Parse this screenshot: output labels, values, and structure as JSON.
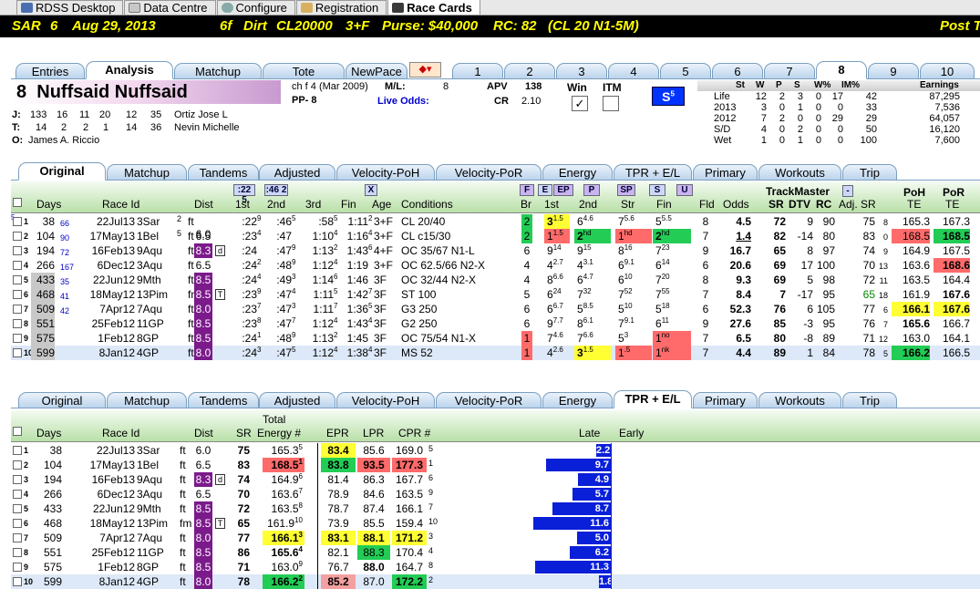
{
  "menu": {
    "tabs": [
      "RDSS Desktop",
      "Data Centre",
      "Configure",
      "Registration",
      "Race Cards"
    ]
  },
  "race": {
    "track": "SAR",
    "race": "6",
    "date": "Aug 29, 2013",
    "dist": "6f",
    "surface": "Dirt",
    "cls": "CL20000",
    "age": "3+F",
    "purse": "Purse: $40,000",
    "rc": "RC: 82",
    "rcdesc": "(CL 20 N1-5M)",
    "post": "Post T"
  },
  "tabs1": [
    "Entries",
    "Analysis",
    "Matchup",
    "Tote",
    "NewPace",
    "1",
    "2",
    "3",
    "4",
    "5",
    "6",
    "7",
    "8",
    "9",
    "10"
  ],
  "horse": {
    "pp_no": "8",
    "name": "Nuffsaid Nuffsaid",
    "desc": "ch f 4  (Mar 2009)",
    "pp": "PP- 8",
    "ml_label": "M/L:",
    "ml": "8",
    "live": "Live Odds:",
    "apv_l": "APV",
    "apv": "138",
    "cr_l": "CR",
    "cr": "2.10",
    "win": "Win",
    "itm": "ITM",
    "s_badge": "S",
    "s_sup": "5",
    "j_label": "J:",
    "j_stats": [
      "133",
      "16",
      "11",
      "20",
      "12",
      "35"
    ],
    "jockey": "Ortiz Jose L",
    "t_label": "T:",
    "t_stats": [
      "14",
      "2",
      "2",
      "1",
      "14",
      "36"
    ],
    "trainer": "Nevin Michelle",
    "o_label": "O:",
    "owner": "James A. Riccio"
  },
  "career": {
    "headers": [
      "St",
      "W",
      "P",
      "S",
      "W%",
      "IM%",
      "Earnings"
    ],
    "rows": [
      [
        "Life",
        "12",
        "2",
        "3",
        "0",
        "17",
        "42",
        "87,295"
      ],
      [
        "2013",
        "3",
        "0",
        "1",
        "0",
        "0",
        "33",
        "7,536"
      ],
      [
        "2012",
        "7",
        "2",
        "0",
        "0",
        "29",
        "29",
        "64,057"
      ],
      [
        "S/D",
        "4",
        "0",
        "2",
        "0",
        "0",
        "50",
        "16,120"
      ],
      [
        "Wet",
        "1",
        "0",
        "1",
        "0",
        "0",
        "100",
        "7,600"
      ]
    ]
  },
  "tabs2": [
    "Original",
    "Matchup",
    "Tandems",
    "Adjusted",
    "Velocity-PoH",
    "Velocity-PoR",
    "Energy",
    "TPR + E/L",
    "Primary",
    "Workouts",
    "Trip"
  ],
  "grid1": {
    "hdr_btns": [
      ":22 5",
      ":46 2",
      "X",
      "F",
      "E",
      "EP",
      "P",
      "SP",
      "S",
      "U"
    ],
    "headers": {
      "days": "Days",
      "raceid": "Race Id",
      "dist": "Dist",
      "f1": "1st",
      "f2": "2nd",
      "f3": "3rd",
      "fin": "Fin",
      "age": "Age",
      "cond": "Conditions",
      "br": "Br",
      "c1": "1st",
      "c2": "2nd",
      "str": "Str",
      "cfin": "Fin",
      "fld": "Fld",
      "odds": "Odds",
      "tm": "TrackMaster",
      "sr": "SR",
      "dtv": "DTV",
      "rc": "RC",
      "adj": "Adj. SR",
      "poh": "PoH",
      "por": "PoR",
      "te": "TE",
      "te2": "TE"
    },
    "rows": [
      {
        "n": "1",
        "days": "38",
        "dsup": "5",
        "dsub": "66",
        "date": "22Jul13",
        "trk": "3Sar",
        "rs": "2",
        "sf": "ft",
        "dist": "6.0",
        "f1": ":22",
        "f1s": "9",
        "f2": ":46",
        "f2s": "5",
        "f3": ":58",
        "f3s": "5",
        "fin": "1:11",
        "fins": "2",
        "age": "3+F",
        "cond": "CL 20/40",
        "br": "2",
        "c1": "3",
        "c1s": "1.5",
        "c2": "6",
        "c2s": "4.6",
        "str": "7",
        "strs": "5.6",
        "cfin": "5",
        "cfins": "5.5",
        "fld": "8",
        "odds": "4.5",
        "sr": "72",
        "dtv": "9",
        "rc": "90",
        "adj": "75",
        "adjs": "8",
        "poh": "165.3",
        "por": "167.3"
      },
      {
        "n": "2",
        "days": "104",
        "dsup": "",
        "dsub": "90",
        "date": "17May13",
        "trk": "1Bel",
        "rs": "5",
        "sf": "ft",
        "dist": "6.5",
        "f1": ":23",
        "f1s": "4",
        "f2": ":47",
        "f2s": "",
        "f3": "1:10",
        "f3s": "4",
        "fin": "1:16",
        "fins": "4",
        "age": "3+F",
        "cond": "CL c15/30",
        "br": "2",
        "c1": "1",
        "c1s": "1.5",
        "c2": "2",
        "c2s": "hd",
        "str": "1",
        "strs": "hd",
        "cfin": "2",
        "cfins": "hd",
        "fld": "7",
        "odds": "1.4",
        "sr": "82",
        "dtv": "-14",
        "rc": "80",
        "adj": "83",
        "adjs": "0",
        "poh": "168.5",
        "por": "168.5"
      },
      {
        "n": "3",
        "days": "194",
        "dsup": "",
        "dsub": "72",
        "date": "16Feb13",
        "trk": "9Aqu",
        "rs": "",
        "sf": "ft",
        "dist": "8.3",
        "f1": ":24",
        "f1s": "",
        "f2": ":47",
        "f2s": "9",
        "f3": "1:13",
        "f3s": "2",
        "fin": "1:43",
        "fins": "6",
        "age": "4+F",
        "cond": "OC 35/67 N1-L",
        "br": "6",
        "c1": "9",
        "c1s": "14",
        "c2": "9",
        "c2s": "15",
        "str": "8",
        "strs": "16",
        "cfin": "7",
        "cfins": "23",
        "fld": "9",
        "odds": "16.7",
        "sr": "65",
        "dtv": "8",
        "rc": "97",
        "adj": "74",
        "adjs": "9",
        "poh": "164.9",
        "por": "167.5"
      },
      {
        "n": "4",
        "days": "266",
        "dsup": "",
        "dsub": "167",
        "date": "6Dec12",
        "trk": "3Aqu",
        "rs": "",
        "sf": "ft",
        "dist": "6.5",
        "f1": ":24",
        "f1s": "2",
        "f2": ":48",
        "f2s": "9",
        "f3": "1:12",
        "f3s": "4",
        "fin": "1:19",
        "fins": "",
        "age": "3+F",
        "cond": "OC 62.5/66 N2-X",
        "br": "4",
        "c1": "4",
        "c1s": "2.7",
        "c2": "4",
        "c2s": "3.1",
        "str": "6",
        "strs": "9.1",
        "cfin": "6",
        "cfins": "14",
        "fld": "6",
        "odds": "20.6",
        "sr": "69",
        "dtv": "17",
        "rc": "100",
        "adj": "70",
        "adjs": "13",
        "poh": "163.6",
        "por": "168.6"
      },
      {
        "n": "5",
        "days": "433",
        "dsup": "",
        "dsub": "35",
        "date": "22Jun12",
        "trk": "9Mth",
        "rs": "",
        "sf": "ft",
        "dist": "8.5",
        "f1": ":24",
        "f1s": "4",
        "f2": ":49",
        "f2s": "3",
        "f3": "1:14",
        "f3s": "6",
        "fin": "1:46",
        "fins": "",
        "age": "3F",
        "cond": "OC 32/44 N2-X",
        "br": "4",
        "c1": "8",
        "c1s": "6.6",
        "c2": "6",
        "c2s": "4.7",
        "str": "6",
        "strs": "10",
        "cfin": "7",
        "cfins": "20",
        "fld": "8",
        "odds": "9.3",
        "sr": "69",
        "dtv": "5",
        "rc": "98",
        "adj": "72",
        "adjs": "11",
        "poh": "163.5",
        "por": "164.4"
      },
      {
        "n": "6",
        "days": "468",
        "dsup": "",
        "dsub": "41",
        "date": "18May12",
        "trk": "13Pim",
        "rs": "",
        "sf": "fm",
        "dist": "8.5",
        "f1": ":23",
        "f1s": "9",
        "f2": ":47",
        "f2s": "4",
        "f3": "1:11",
        "f3s": "5",
        "fin": "1:42",
        "fins": "7",
        "age": "3F",
        "cond": "ST 100",
        "br": "5",
        "c1": "6",
        "c1s": "24",
        "c2": "7",
        "c2s": "32",
        "str": "7",
        "strs": "52",
        "cfin": "7",
        "cfins": "55",
        "fld": "7",
        "odds": "8.4",
        "sr": "7",
        "dtv": "-17",
        "rc": "95",
        "adj": "65",
        "adjs": "18",
        "poh": "161.9",
        "por": "167.6"
      },
      {
        "n": "7",
        "days": "509",
        "dsup": "",
        "dsub": "42",
        "date": "7Apr12",
        "trk": "7Aqu",
        "rs": "",
        "sf": "ft",
        "dist": "8.0",
        "f1": ":23",
        "f1s": "7",
        "f2": ":47",
        "f2s": "3",
        "f3": "1:11",
        "f3s": "7",
        "fin": "1:36",
        "fins": "5",
        "age": "3F",
        "cond": "G3 250",
        "br": "6",
        "c1": "6",
        "c1s": "6.7",
        "c2": "5",
        "c2s": "8.5",
        "str": "5",
        "strs": "10",
        "cfin": "5",
        "cfins": "18",
        "fld": "6",
        "odds": "52.3",
        "sr": "76",
        "dtv": "6",
        "rc": "105",
        "adj": "77",
        "adjs": "6",
        "poh": "166.1",
        "por": "167.6"
      },
      {
        "n": "8",
        "days": "551",
        "dsup": "",
        "dsub": "",
        "date": "25Feb12",
        "trk": "11GP",
        "rs": "",
        "sf": "ft",
        "dist": "8.5",
        "f1": ":23",
        "f1s": "8",
        "f2": ":47",
        "f2s": "7",
        "f3": "1:12",
        "f3s": "4",
        "fin": "1:43",
        "fins": "4",
        "age": "3F",
        "cond": "G2 250",
        "br": "6",
        "c1": "9",
        "c1s": "7.7",
        "c2": "8",
        "c2s": "6.1",
        "str": "7",
        "strs": "9.1",
        "cfin": "6",
        "cfins": "11",
        "fld": "9",
        "odds": "27.6",
        "sr": "85",
        "dtv": "-3",
        "rc": "95",
        "adj": "76",
        "adjs": "7",
        "poh": "165.6",
        "por": "166.7"
      },
      {
        "n": "9",
        "days": "575",
        "dsup": "",
        "dsub": "",
        "date": "1Feb12",
        "trk": "8GP",
        "rs": "",
        "sf": "ft",
        "dist": "8.5",
        "f1": ":24",
        "f1s": "1",
        "f2": ":48",
        "f2s": "9",
        "f3": "1:13",
        "f3s": "2",
        "fin": "1:45",
        "fins": "",
        "age": "3F",
        "cond": "OC 75/54 N1-X",
        "br": "1",
        "c1": "7",
        "c1s": "4.6",
        "c2": "7",
        "c2s": "6.6",
        "str": "5",
        "strs": "3",
        "cfin": "1",
        "cfins": "no",
        "fld": "7",
        "odds": "6.5",
        "sr": "80",
        "dtv": "-8",
        "rc": "89",
        "adj": "71",
        "adjs": "12",
        "poh": "163.0",
        "por": "164.1"
      },
      {
        "n": "10",
        "days": "599",
        "dsup": "",
        "dsub": "",
        "date": "8Jan12",
        "trk": "4GP",
        "rs": "",
        "sf": "ft",
        "dist": "8.0",
        "f1": ":24",
        "f1s": "3",
        "f2": ":47",
        "f2s": "5",
        "f3": "1:12",
        "f3s": "4",
        "fin": "1:38",
        "fins": "4",
        "age": "3F",
        "cond": "MS 52",
        "br": "1",
        "c1": "4",
        "c1s": "2.6",
        "c2": "3",
        "c2s": "1.5",
        "str": "1",
        "strs": ".5",
        "cfin": "1",
        "cfins": "nk",
        "fld": "7",
        "odds": "4.4",
        "sr": "89",
        "dtv": "1",
        "rc": "84",
        "adj": "78",
        "adjs": "5",
        "poh": "166.2",
        "por": "166.5"
      }
    ]
  },
  "grid2": {
    "headers": {
      "days": "Days",
      "raceid": "Race Id",
      "dist": "Dist",
      "sr": "SR",
      "total": "Total",
      "energy": "Energy #",
      "epr": "EPR",
      "lpr": "LPR",
      "cpr": "CPR #",
      "late": "Late",
      "early": "Early"
    },
    "rows": [
      {
        "n": "1",
        "days": "38",
        "date": "22Jul13",
        "trk": "3Sar",
        "sf": "ft",
        "dist": "6.0",
        "sr": "75",
        "en": "165.3",
        "ens": "5",
        "epr": "83.4",
        "lpr": "85.6",
        "cpr": "169.0",
        "cprs": "5",
        "late": "2.2",
        "lateval": 2.2
      },
      {
        "n": "2",
        "days": "104",
        "date": "17May13",
        "trk": "1Bel",
        "sf": "ft",
        "dist": "6.5",
        "sr": "83",
        "en": "168.5",
        "ens": "1",
        "epr": "83.8",
        "lpr": "93.5",
        "cpr": "177.3",
        "cprs": "1",
        "late": "9.7",
        "lateval": 9.7
      },
      {
        "n": "3",
        "days": "194",
        "date": "16Feb13",
        "trk": "9Aqu",
        "sf": "ft",
        "dist": "8.3",
        "sr": "74",
        "en": "164.9",
        "ens": "6",
        "epr": "81.4",
        "lpr": "86.3",
        "cpr": "167.7",
        "cprs": "6",
        "late": "4.9",
        "lateval": 4.9
      },
      {
        "n": "4",
        "days": "266",
        "date": "6Dec12",
        "trk": "3Aqu",
        "sf": "ft",
        "dist": "6.5",
        "sr": "70",
        "en": "163.6",
        "ens": "7",
        "epr": "78.9",
        "lpr": "84.6",
        "cpr": "163.5",
        "cprs": "9",
        "late": "5.7",
        "lateval": 5.7
      },
      {
        "n": "5",
        "days": "433",
        "date": "22Jun12",
        "trk": "9Mth",
        "sf": "ft",
        "dist": "8.5",
        "sr": "72",
        "en": "163.5",
        "ens": "8",
        "epr": "78.7",
        "lpr": "87.4",
        "cpr": "166.1",
        "cprs": "7",
        "late": "8.7",
        "lateval": 8.7
      },
      {
        "n": "6",
        "days": "468",
        "date": "18May12",
        "trk": "13Pim",
        "sf": "fm",
        "dist": "8.5",
        "sr": "65",
        "en": "161.9",
        "ens": "10",
        "epr": "73.9",
        "lpr": "85.5",
        "cpr": "159.4",
        "cprs": "10",
        "late": "11.6",
        "lateval": 11.6
      },
      {
        "n": "7",
        "days": "509",
        "date": "7Apr12",
        "trk": "7Aqu",
        "sf": "ft",
        "dist": "8.0",
        "sr": "77",
        "en": "166.1",
        "ens": "3",
        "epr": "83.1",
        "lpr": "88.1",
        "cpr": "171.2",
        "cprs": "3",
        "late": "5.0",
        "lateval": 5.0
      },
      {
        "n": "8",
        "days": "551",
        "date": "25Feb12",
        "trk": "11GP",
        "sf": "ft",
        "dist": "8.5",
        "sr": "86",
        "en": "165.6",
        "ens": "4",
        "epr": "82.1",
        "lpr": "88.3",
        "cpr": "170.4",
        "cprs": "4",
        "late": "6.2",
        "lateval": 6.2
      },
      {
        "n": "9",
        "days": "575",
        "date": "1Feb12",
        "trk": "8GP",
        "sf": "ft",
        "dist": "8.5",
        "sr": "71",
        "en": "163.0",
        "ens": "9",
        "epr": "76.7",
        "lpr": "88.0",
        "cpr": "164.7",
        "cprs": "8",
        "late": "11.3",
        "lateval": 11.3
      },
      {
        "n": "10",
        "days": "599",
        "date": "8Jan12",
        "trk": "4GP",
        "sf": "ft",
        "dist": "8.0",
        "sr": "78",
        "en": "166.2",
        "ens": "2",
        "epr": "85.2",
        "lpr": "87.0",
        "cpr": "172.2",
        "cprs": "2",
        "late": "1.8",
        "lateval": 1.8
      }
    ]
  }
}
